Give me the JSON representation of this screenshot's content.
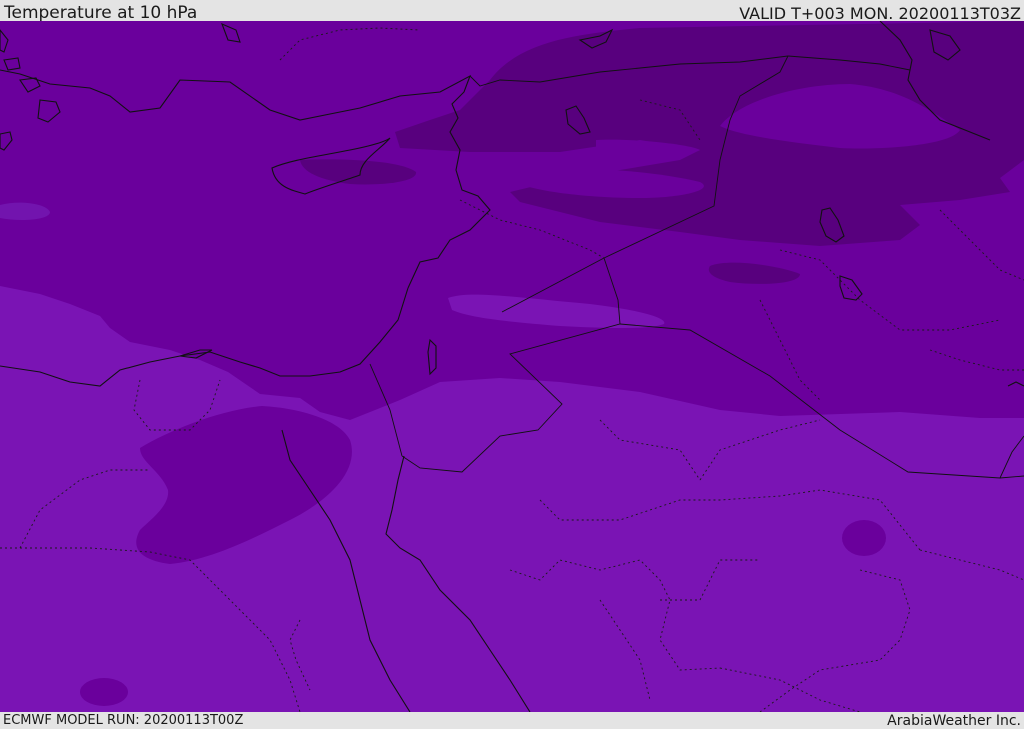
{
  "header": {
    "title": "Temperature at 10 hPa",
    "valid": "VALID T+003 MON. 20200113T03Z"
  },
  "footer": {
    "model_run": "ECMWF MODEL RUN: 20200113T00Z",
    "credit": "ArabiaWeather Inc."
  },
  "map": {
    "field": "temperature-10hPa",
    "colors": {
      "band_warm": "#7a14b4",
      "band_mid": "#6a009c",
      "band_cold": "#58007e",
      "coastline": "#111111",
      "border": "#111111"
    }
  }
}
